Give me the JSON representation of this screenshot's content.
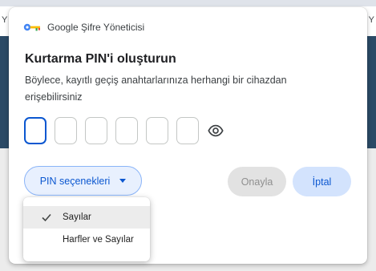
{
  "background": {
    "left_fragment": "Y",
    "right_fragment": "Y"
  },
  "dialog": {
    "header_title": "Google Şifre Yöneticisi",
    "title": "Kurtarma PIN'i oluşturun",
    "description": "Böylece, kayıtlı geçiş anahtarlarınıza herhangi bir cihazdan erişebilirsiniz",
    "pin_fields_count": 6,
    "pin_options_label": "PIN seçenekleri",
    "confirm_label": "Onayla",
    "cancel_label": "İptal"
  },
  "dropdown": {
    "items": [
      {
        "label": "Sayılar",
        "selected": true
      },
      {
        "label": "Harfler ve Sayılar",
        "selected": false
      }
    ]
  },
  "colors": {
    "accent": "#0b57d0",
    "accent_light": "#d3e3fd",
    "disabled_bg": "#e2e2e2",
    "disabled_text": "#8f8f8f"
  },
  "icons": {
    "header": "key-icon",
    "visibility": "eye-icon",
    "dropdown": "caret-down-icon",
    "selected": "checkmark-icon"
  }
}
